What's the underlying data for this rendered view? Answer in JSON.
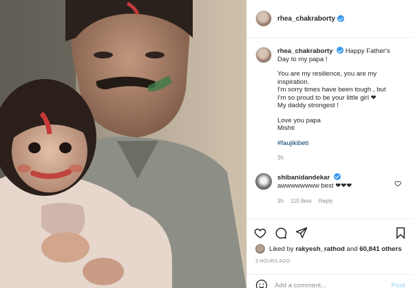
{
  "post": {
    "username": "rhea_chakraborty",
    "caption": {
      "first": "Happy Father's",
      "second": "Day to my papa !",
      "p2": [
        "You are my resilience, you are my",
        "inspiration.",
        "I'm sorry times have been tough , but",
        "I'm so proud to be your little girl ❤",
        "My daddy strongest !"
      ],
      "p3": [
        "Love you papa",
        "Mishti"
      ],
      "hashtag": "#faujikibeti",
      "time": "3h"
    },
    "comment": {
      "username": "shibanidandekar",
      "text": "awwwwwwww best ❤❤❤",
      "time": "3h",
      "likes": "115 likes",
      "reply": "Reply"
    },
    "liked_by": {
      "prefix": "Liked by",
      "user": "rakyesh_rathod",
      "middle": "and",
      "count": "60,841 others"
    },
    "time_ago": "3 HOURS AGO",
    "add_comment": {
      "placeholder": "Add a comment...",
      "post_label": "Post"
    }
  },
  "icons": {
    "like": "heart-icon",
    "comment": "comment-icon",
    "share": "share-icon",
    "save": "bookmark-icon",
    "emoji": "smiley-icon",
    "verified": "verified-badge-icon"
  },
  "colors": {
    "verified": "#3897f0",
    "hashtag": "#00376b",
    "muted": "#8e8e8e",
    "post_disabled": "#b2dffc"
  }
}
